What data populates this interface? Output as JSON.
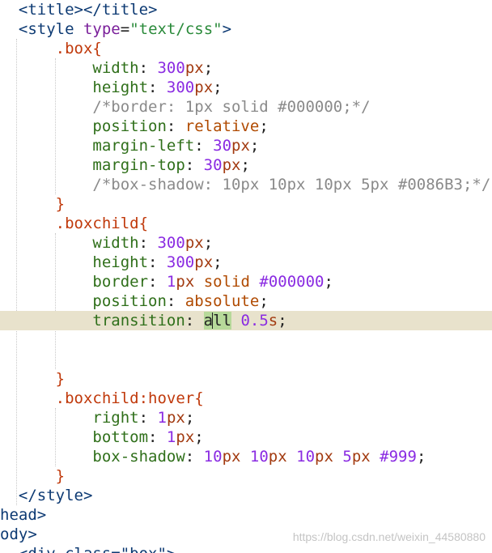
{
  "code": {
    "l0_open": "<title>",
    "l0_close": "</title>",
    "l1_tag": "<style",
    "l1_attr": "type",
    "l1_eq": "=",
    "l1_val": "\"text/css\"",
    "l1_end": ">",
    "box_sel": ".box",
    "brace_open": "{",
    "brace_close": "}",
    "width_prop": "width",
    "height_prop": "height",
    "colon": ": ",
    "semi": ";",
    "v300": "300",
    "px": "px",
    "border_comment": "/*border: 1px solid #000000;*/",
    "position_prop": "position",
    "relative_val": "relative",
    "margin_left_prop": "margin-left",
    "margin_top_prop": "margin-top",
    "v30": "30",
    "shadow_comment": "/*box-shadow: 10px 10px 10px 5px #0086B3;*/",
    "boxchild_sel": ".boxchild",
    "border_prop": "border",
    "v1": "1",
    "solid_val": "solid",
    "color000": "#000000",
    "absolute_val": "absolute",
    "transition_prop": "transition",
    "all_val": "all",
    "v05": "0.5",
    "s_unit": "s",
    "hover_sel": ".boxchild:hover",
    "right_prop": "right",
    "bottom_prop": "bottom",
    "boxshadow_prop": "box-shadow",
    "v10": "10",
    "v5": "5",
    "color999": "#999",
    "style_close": "</style>",
    "head_close": "head>",
    "body_open": "ody>",
    "div_line": "<div class=\"box\">"
  },
  "watermark": "https://blog.csdn.net/weixin_44580880"
}
